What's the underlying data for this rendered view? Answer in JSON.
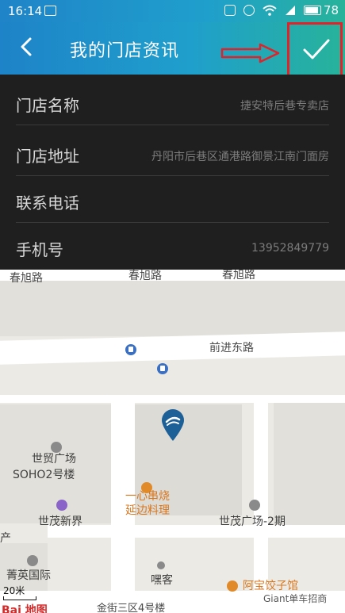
{
  "status_bar": {
    "time": "16:14",
    "battery": "78"
  },
  "app_bar": {
    "title": "我的门店资讯"
  },
  "form": {
    "rows": [
      {
        "label": "门店名称",
        "value": "捷安特后巷专卖店"
      },
      {
        "label": "门店地址",
        "value": "丹阳市后巷区通港路御景江南门面房"
      },
      {
        "label": "联系电话",
        "value": ""
      },
      {
        "label": "手机号",
        "value": "13952849779"
      }
    ]
  },
  "map": {
    "streets": [
      "春旭路",
      "春旭路",
      "春旭路",
      "前进东路",
      "金街三区4号楼"
    ],
    "pois": {
      "shimao_plaza": "世贸广场",
      "soho": "SOHO2号楼",
      "yixin_1": "一心串烧",
      "yixin_2": "延边料理",
      "shimao_new": "世茂新界",
      "shimao_2": "世茂广场-2期",
      "jingying": "菁英国际",
      "heike": "嘿客",
      "abao": "阿宝饺子馆",
      "partial_left": "产"
    },
    "scale": "20米",
    "logo": "Bai 地图"
  },
  "watermark": "Giant单车招商",
  "colors": {
    "appbar_start": "#1e83c8",
    "appbar_end": "#27b39a",
    "form_bg": "#1f1f1f",
    "highlight": "#e0232b"
  }
}
